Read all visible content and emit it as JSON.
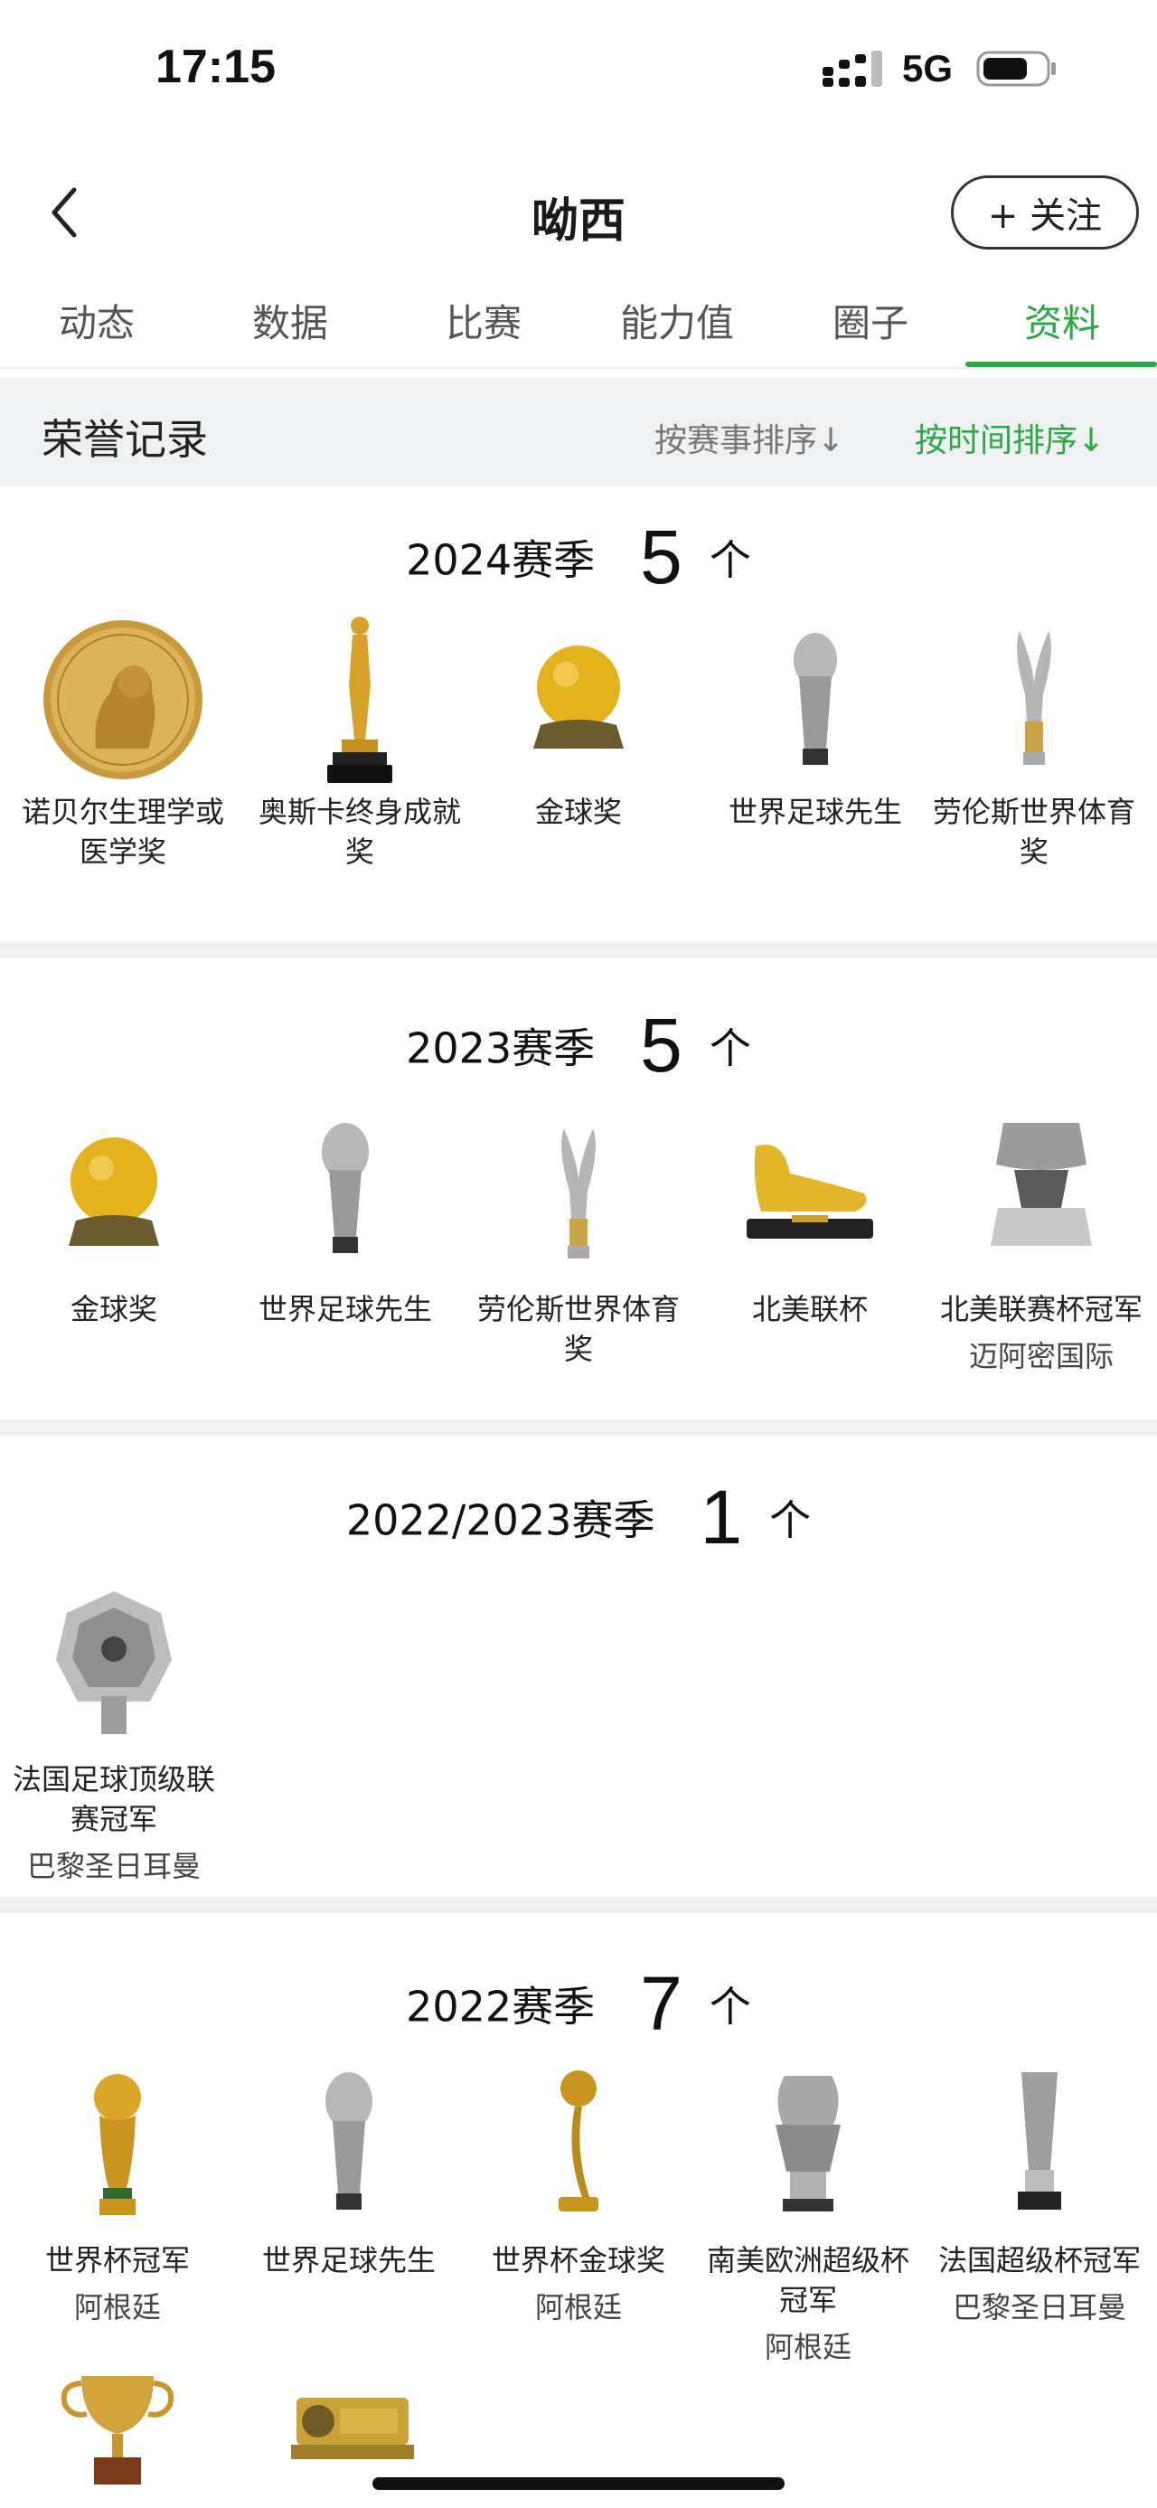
{
  "status_bar": {
    "time": "17:15",
    "network": "5G"
  },
  "header": {
    "title": "呦西",
    "follow_label": "+ 关注"
  },
  "tabs": [
    {
      "label": "动态",
      "active": false
    },
    {
      "label": "数据",
      "active": false
    },
    {
      "label": "比赛",
      "active": false
    },
    {
      "label": "能力值",
      "active": false
    },
    {
      "label": "圈子",
      "active": false
    },
    {
      "label": "资料",
      "active": true
    }
  ],
  "honors": {
    "title": "荣誉记录",
    "sort_by_event": "按赛事排序↓",
    "sort_by_time": "按时间排序↓"
  },
  "colors": {
    "accent": "#29a843",
    "gold": "#d4a52b",
    "silver": "#a9a9a9",
    "section_bg": "#eef0f1"
  },
  "seasons": [
    {
      "name": "2024赛季",
      "count": "5",
      "unit": "个",
      "awards": [
        {
          "name": "诺贝尔生理学或医学奖",
          "icon": "nobel-medal-icon"
        },
        {
          "name": "奥斯卡终身成就奖",
          "icon": "oscar-statuette-icon"
        },
        {
          "name": "金球奖",
          "icon": "golden-ball-icon"
        },
        {
          "name": "世界足球先生",
          "icon": "fifa-best-trophy-icon"
        },
        {
          "name": "劳伦斯世界体育奖",
          "icon": "laureus-statuette-icon"
        }
      ]
    },
    {
      "name": "2023赛季",
      "count": "5",
      "unit": "个",
      "awards": [
        {
          "name": "金球奖",
          "icon": "golden-ball-icon"
        },
        {
          "name": "世界足球先生",
          "icon": "fifa-best-trophy-icon"
        },
        {
          "name": "劳伦斯世界体育奖",
          "icon": "laureus-statuette-icon"
        },
        {
          "name": "北美联杯",
          "icon": "golden-boot-icon"
        },
        {
          "name": "北美联赛杯冠军",
          "team": "迈阿密国际",
          "icon": "silver-cup-icon"
        }
      ]
    },
    {
      "name": "2022/2023赛季",
      "count": "1",
      "unit": "个",
      "awards": [
        {
          "name": "法国足球顶级联赛冠军",
          "team": "巴黎圣日耳曼",
          "icon": "ligue1-trophy-icon"
        }
      ]
    },
    {
      "name": "2022赛季",
      "count": "7",
      "unit": "个",
      "awards": [
        {
          "name": "世界杯冠军",
          "team": "阿根廷",
          "icon": "world-cup-trophy-icon"
        },
        {
          "name": "世界足球先生",
          "icon": "fifa-best-trophy-icon"
        },
        {
          "name": "世界杯金球奖",
          "team": "阿根廷",
          "icon": "golden-ball-award-icon"
        },
        {
          "name": "南美欧洲超级杯冠军",
          "team": "阿根廷",
          "icon": "finalissima-trophy-icon"
        },
        {
          "name": "法国超级杯冠军",
          "team": "巴黎圣日耳曼",
          "icon": "super-cup-trophy-icon"
        },
        {
          "name": "",
          "icon": "gold-cup-icon"
        },
        {
          "name": "",
          "icon": "mvp-plaque-icon"
        }
      ]
    }
  ]
}
